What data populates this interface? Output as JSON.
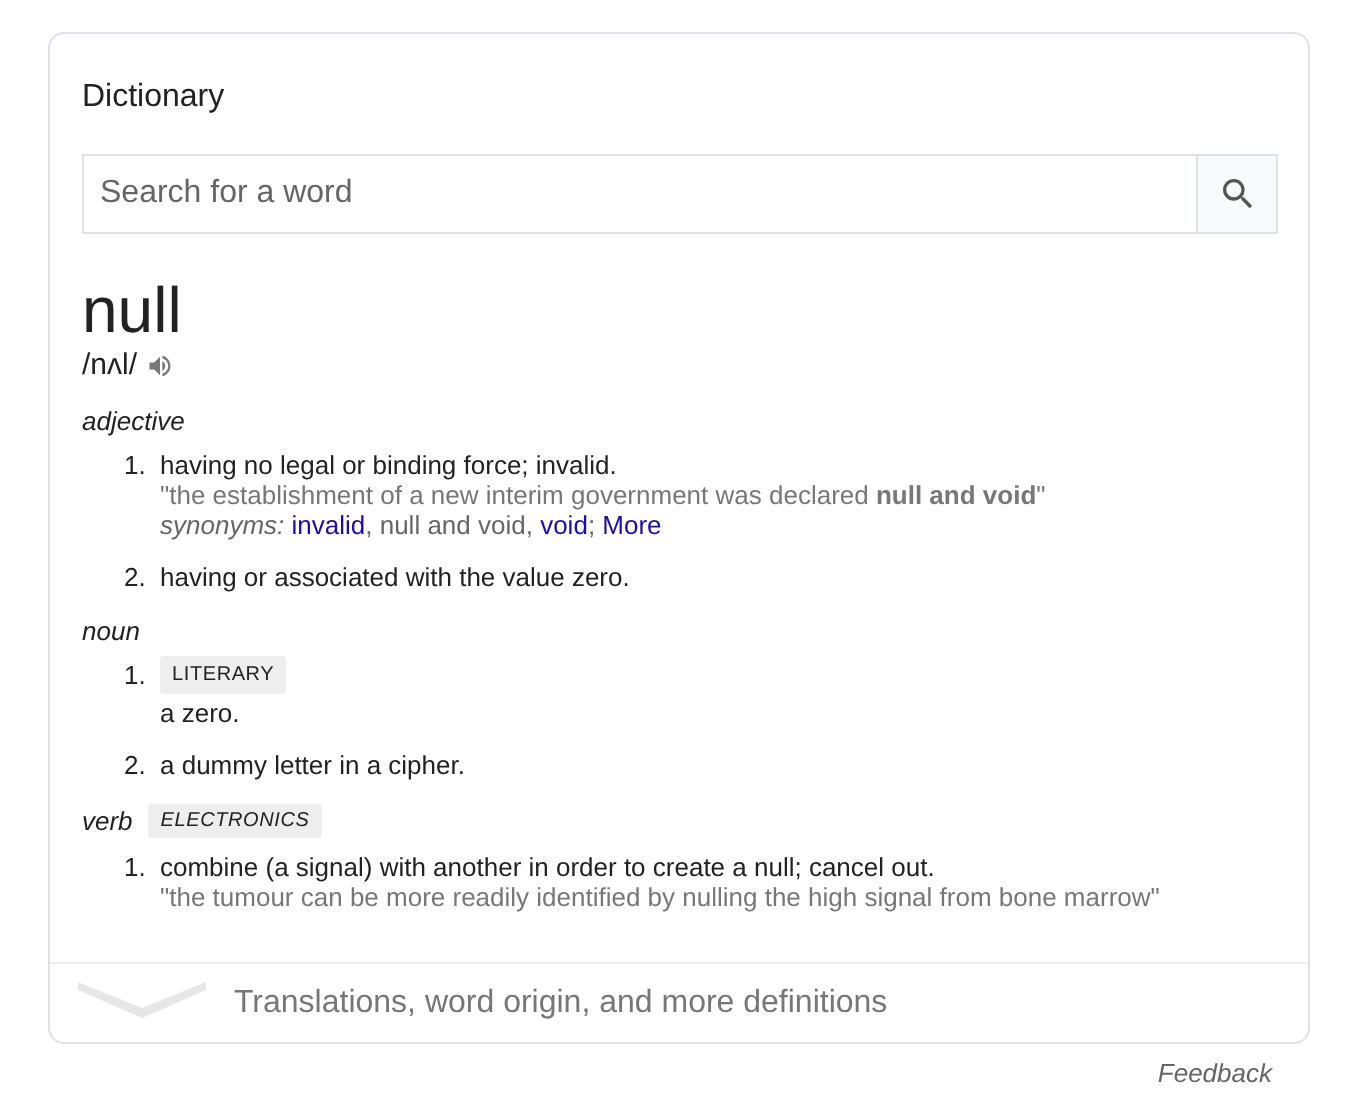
{
  "card": {
    "title": "Dictionary"
  },
  "search": {
    "placeholder": "Search for a word"
  },
  "entry": {
    "word": "null",
    "phonetic": "/nʌl/"
  },
  "groups": [
    {
      "pos": "adjective",
      "senses": [
        {
          "number": "1.",
          "definition": "having no legal or binding force; invalid.",
          "example": "\"the establishment of a new interim government was declared **null and void**\"",
          "synonyms_label": "synonyms:",
          "synonyms": [
            {
              "text": "invalid",
              "link": true
            },
            {
              "text": ", null and void, ",
              "link": false
            },
            {
              "text": "void",
              "link": true
            },
            {
              "text": ";  ",
              "link": false
            },
            {
              "text": "More",
              "link": true
            }
          ]
        },
        {
          "number": "2.",
          "definition": "having or associated with the value zero."
        }
      ]
    },
    {
      "pos": "noun",
      "senses": [
        {
          "number": "1.",
          "tag": "LITERARY",
          "definition": "a zero."
        },
        {
          "number": "2.",
          "definition": "a dummy letter in a cipher."
        }
      ]
    },
    {
      "pos": "verb",
      "tag": "ELECTRONICS",
      "senses": [
        {
          "number": "1.",
          "definition": "combine (a signal) with another in order to create a null; cancel out.",
          "example": "\"the tumour can be more readily identified by nulling the high signal from bone marrow\""
        }
      ]
    }
  ],
  "more": {
    "label": "Translations, word origin, and more definitions"
  },
  "feedback": "Feedback"
}
